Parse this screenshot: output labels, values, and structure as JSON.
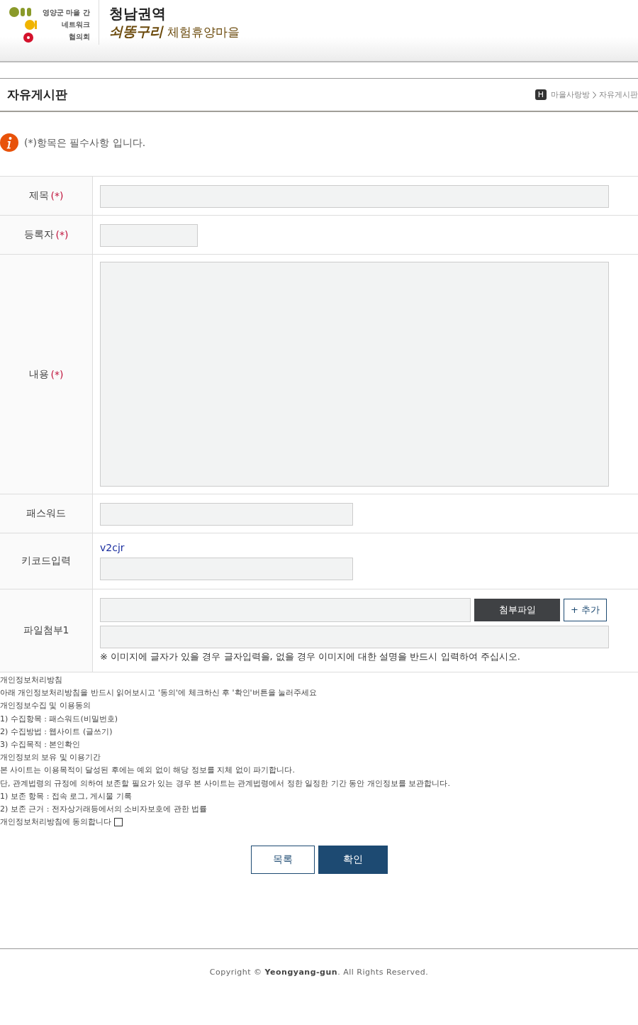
{
  "header": {
    "logo_lines": [
      "영양군 마을 간",
      "네트워크",
      "협의회"
    ],
    "site_title": "청남권역",
    "site_brand": "쇠똥구리",
    "site_subtitle": "체험휴양마을"
  },
  "page_title": "자유게시판",
  "breadcrumb": {
    "home": "H",
    "items": [
      "마을사랑방",
      "자유게시판"
    ]
  },
  "notice": "(*)항목은 필수사항 입니다.",
  "form_rows": [
    {
      "label": "제목",
      "required": "(*)",
      "kind": "wide_text"
    },
    {
      "label": "등록자",
      "required": "(*)",
      "kind": "short_text"
    },
    {
      "label": "내용",
      "required": "(*)",
      "kind": "textarea"
    },
    {
      "label": "패스워드",
      "kind": "medium_text"
    },
    {
      "label": "키코드입력",
      "kind": "captcha",
      "code": "v2cjr"
    },
    {
      "label": "파일첨부1",
      "kind": "file",
      "attach_button": "첨부파일",
      "add_button": "+ 추가",
      "note": "※ 이미지에 글자가 있을 경우 글자입력을, 없을 경우 이미지에 대한 설명을 반드시 입력하여 주십시오."
    }
  ],
  "privacy_lines": [
    "개인정보처리방침",
    "아래 개인정보처리방침을 반드시 읽어보시고 '동의'에 체크하신 후 '확인'버튼을 눌러주세요",
    "개인정보수집 및 이용동의",
    "1) 수집항목 : 패스워드(비밀번호)",
    "2) 수집방법 : 웹사이트 (글쓰기)",
    "3) 수집목적 : 본인확인",
    "개인정보의 보유 및 이용기간",
    "본 사이트는 이용목적이 달성된 후에는 예외 없이 해당 정보를 지체 없이 파기합니다.",
    "단, 관계법령의 규정에 의하여 보존할 필요가 있는 경우 본 사이트는 관계법령에서 정한 일정한 기간 동안 개인정보를 보관합니다.",
    "1) 보존 항목 : 접속 로그, 게시물 기록",
    "2) 보존 근거 : 전자상거래등에서의 소비자보호에 관한 법률"
  ],
  "agree": {
    "label": "개인정보처리방침에 동의합니다",
    "checked": false
  },
  "buttons": [
    {
      "label": "목록",
      "kind": "secondary"
    },
    {
      "label": "확인",
      "kind": "primary"
    }
  ],
  "footer": "Copyright © **Yeongyang-gun**. All Rights Reserved."
}
